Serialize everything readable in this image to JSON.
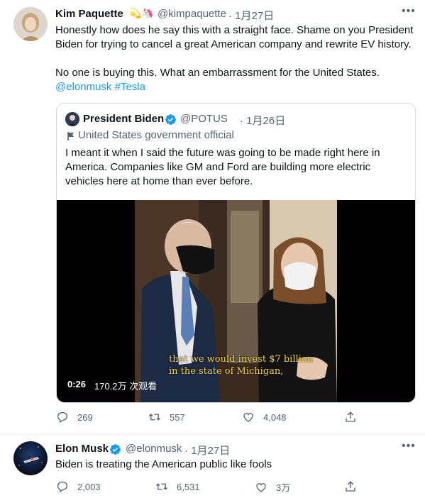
{
  "tweet1": {
    "display_name": "Kim Paquette",
    "emoji": "💫🦄",
    "handle": "@kimpaquette",
    "date": "· 1月27日",
    "text_line1": "Honestly how does he say this with a straight face. Shame on you President",
    "text_line2": "Biden for trying to cancel a great American company and rewrite EV history.",
    "text_line3": "No one is buying this. What an embarrassment for the United States.",
    "mention": "@elonmusk",
    "hashtag": "#Tesla",
    "quoted": {
      "display_name": "President Biden",
      "handle": "@POTUS",
      "date": "· 1月26日",
      "label": "United States government official",
      "text_line1": "I meant it when I said the future was going to be made right here in",
      "text_line2": "America. Companies like GM and Ford are building more electric",
      "text_line3": "vehicles here at home than ever before.",
      "video": {
        "caption_line1": "that we would invest $7 billion",
        "caption_line2": "in the state of Michigan,",
        "time": "0:26",
        "views": "170.2万 次观看"
      }
    },
    "actions": {
      "replies": "269",
      "retweets": "557",
      "likes": "4,048"
    }
  },
  "tweet2": {
    "display_name": "Elon Musk",
    "handle": "@elonmusk",
    "date": "· 1月27日",
    "text": "Biden is treating the American public like fools",
    "actions": {
      "replies": "2,003",
      "retweets": "6,531",
      "likes": "3万"
    }
  },
  "icons": [
    "more-icon",
    "verified-icon",
    "flag-icon",
    "reply-icon",
    "retweet-icon",
    "like-icon",
    "share-icon"
  ],
  "colors": {
    "link": "#1d9bf0",
    "muted": "#536471",
    "verified": "#1d9bf0",
    "caption": "#f2d24b"
  }
}
